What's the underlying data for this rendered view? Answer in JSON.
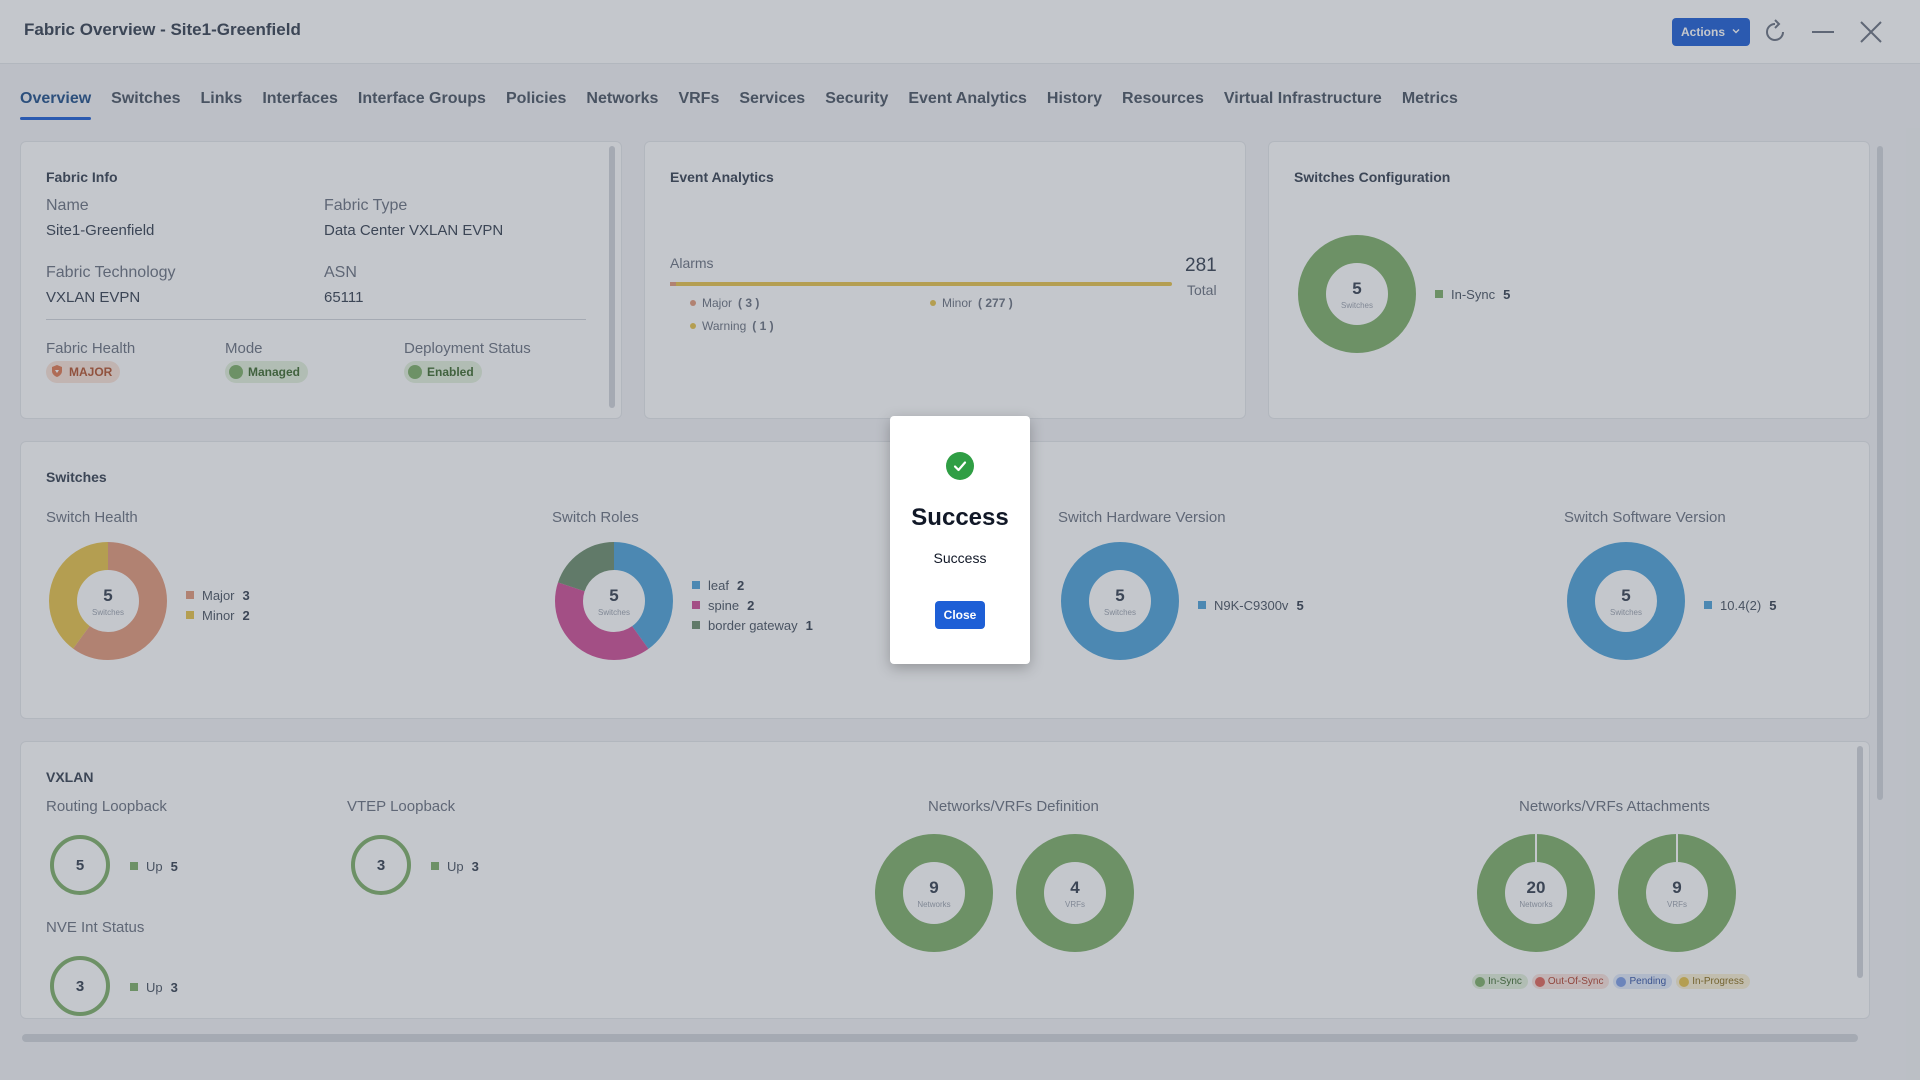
{
  "window": {
    "title": "Fabric Overview - Site1-Greenfield",
    "actions_label": "Actions",
    "icons": [
      "refresh-icon",
      "minimize-icon",
      "close-icon"
    ]
  },
  "tabs": [
    "Overview",
    "Switches",
    "Links",
    "Interfaces",
    "Interface Groups",
    "Policies",
    "Networks",
    "VRFs",
    "Services",
    "Security",
    "Event Analytics",
    "History",
    "Resources",
    "Virtual Infrastructure",
    "Metrics"
  ],
  "active_tab": "Overview",
  "fabric_info": {
    "title": "Fabric Info",
    "name_label": "Name",
    "name_value": "Site1-Greenfield",
    "type_label": "Fabric Type",
    "type_value": "Data Center VXLAN EVPN",
    "tech_label": "Fabric Technology",
    "tech_value": "VXLAN EVPN",
    "asn_label": "ASN",
    "asn_value": "65111",
    "health_label": "Fabric Health",
    "health_value": "MAJOR",
    "mode_label": "Mode",
    "mode_value": "Managed",
    "deploy_label": "Deployment Status",
    "deploy_value": "Enabled"
  },
  "event_analytics": {
    "title": "Event Analytics",
    "alarms_label": "Alarms",
    "total_value": "281",
    "total_label": "Total",
    "major": "Major",
    "major_count": "( 3 )",
    "minor": "Minor",
    "minor_count": "( 277 )",
    "warning": "Warning",
    "warning_count": "( 1 )"
  },
  "switches_config": {
    "title": "Switches Configuration",
    "center_value": "5",
    "center_sub": "Switches",
    "legend_label": "In-Sync",
    "legend_value": "5"
  },
  "switches": {
    "title": "Switches",
    "health": {
      "label": "Switch Health",
      "center": "5",
      "sub": "Switches",
      "items": [
        {
          "name": "Major",
          "value": "3"
        },
        {
          "name": "Minor",
          "value": "2"
        }
      ]
    },
    "roles": {
      "label": "Switch Roles",
      "center": "5",
      "sub": "Switches",
      "items": [
        {
          "name": "leaf",
          "value": "2"
        },
        {
          "name": "spine",
          "value": "2"
        },
        {
          "name": "border gateway",
          "value": "1"
        }
      ]
    },
    "hardware": {
      "label": "Switch Hardware Version",
      "center": "5",
      "sub": "Switches",
      "items": [
        {
          "name": "N9K-C9300v",
          "value": "5"
        }
      ]
    },
    "software": {
      "label": "Switch Software Version",
      "center": "5",
      "sub": "Switches",
      "items": [
        {
          "name": "10.4(2)",
          "value": "5"
        }
      ]
    }
  },
  "vxlan": {
    "title": "VXLAN",
    "routing": {
      "label": "Routing Loopback",
      "center": "5",
      "legend": "Up",
      "value": "5"
    },
    "vtep": {
      "label": "VTEP Loopback",
      "center": "3",
      "legend": "Up",
      "value": "3"
    },
    "nve": {
      "label": "NVE Int Status",
      "center": "3",
      "legend": "Up",
      "value": "3"
    },
    "definition": {
      "label": "Networks/VRFs Definition",
      "networks": "9",
      "networks_sub": "Networks",
      "vrfs": "4",
      "vrfs_sub": "VRFs"
    },
    "attachments": {
      "label": "Networks/VRFs Attachments",
      "networks": "20",
      "networks_sub": "Networks",
      "vrfs": "9",
      "vrfs_sub": "VRFs"
    },
    "status_legend": [
      "In-Sync",
      "Out-Of-Sync",
      "Pending",
      "In-Progress"
    ]
  },
  "modal": {
    "title": "Success",
    "message": "Success",
    "close_label": "Close"
  },
  "colors": {
    "accent": "#1e5fd6",
    "green": "#7fb069",
    "major": "#e39a7b",
    "minor": "#e8c34a",
    "blue": "#4ea3d9",
    "pink": "#cf4f97",
    "gray_green": "#6d8e6d",
    "success": "#2f9e44"
  }
}
